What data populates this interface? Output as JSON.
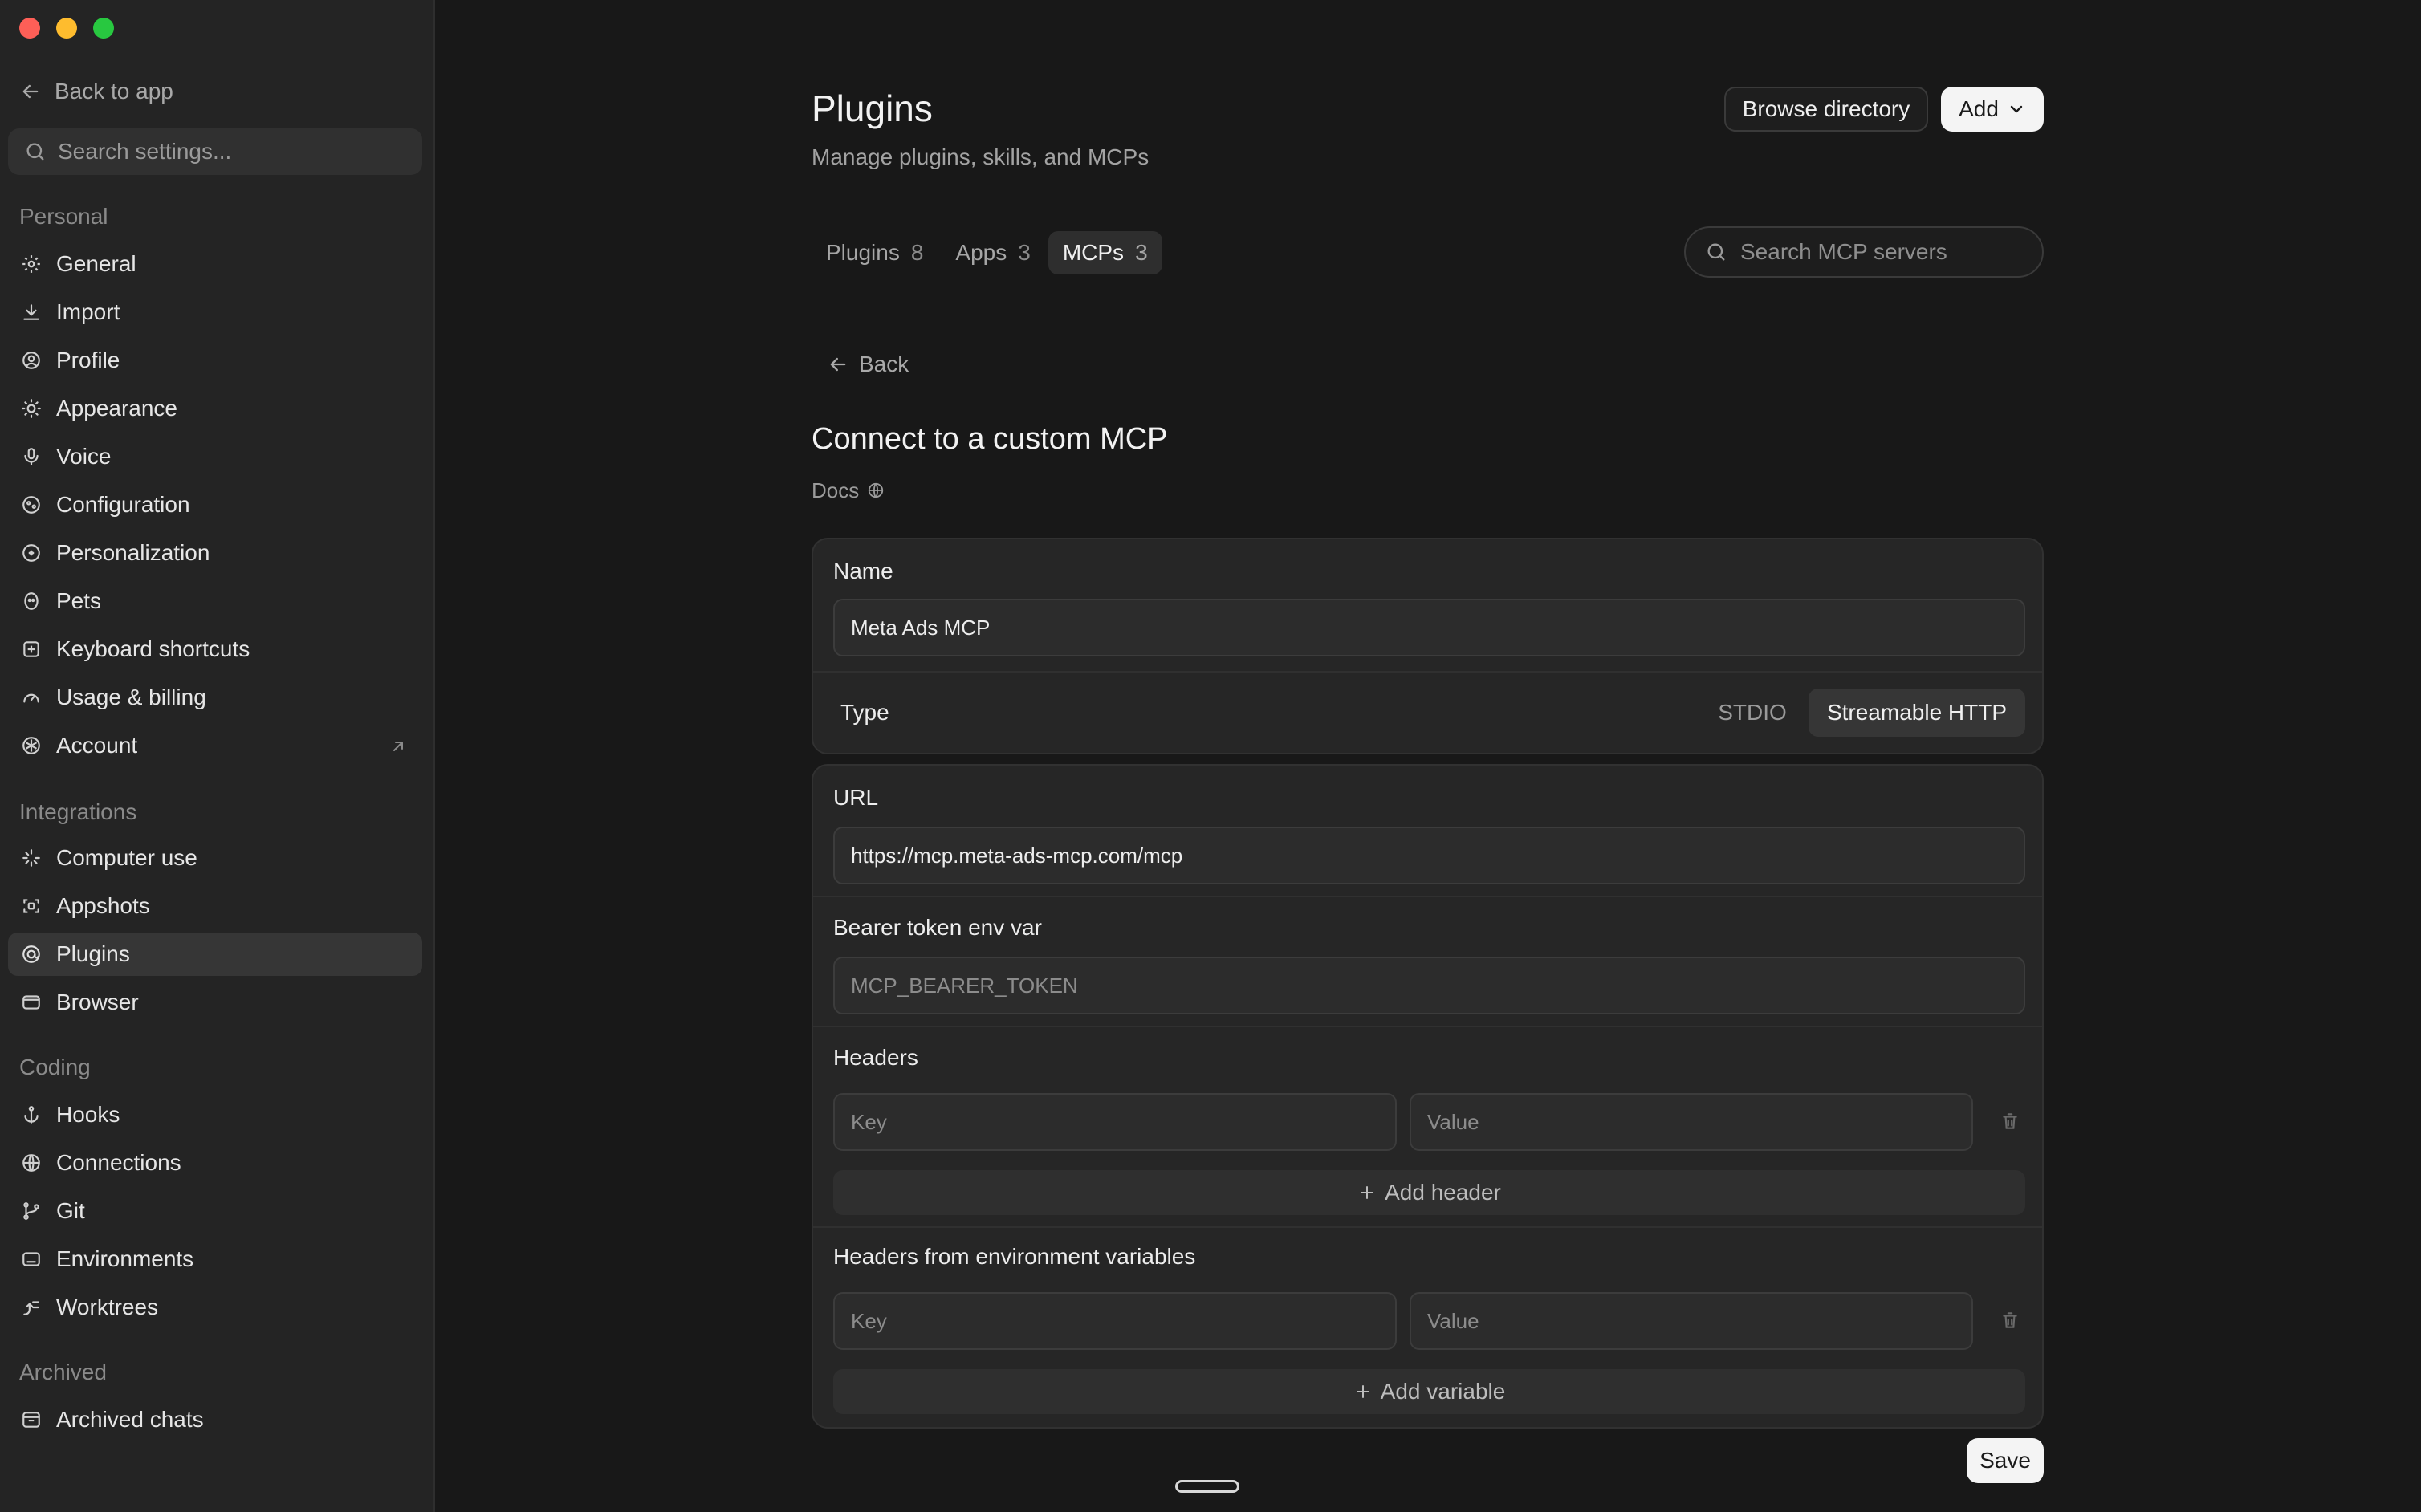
{
  "sidebar": {
    "back_label": "Back to app",
    "search_placeholder": "Search settings...",
    "sections": {
      "personal": "Personal",
      "integrations": "Integrations",
      "coding": "Coding",
      "archived": "Archived"
    },
    "personal_items": [
      {
        "label": "General",
        "icon": "gear-icon"
      },
      {
        "label": "Import",
        "icon": "download-icon"
      },
      {
        "label": "Profile",
        "icon": "user-circle-icon"
      },
      {
        "label": "Appearance",
        "icon": "sun-icon"
      },
      {
        "label": "Voice",
        "icon": "microphone-icon"
      },
      {
        "label": "Configuration",
        "icon": "sliders-icon"
      },
      {
        "label": "Personalization",
        "icon": "sparkle-circle-icon"
      },
      {
        "label": "Pets",
        "icon": "pet-icon"
      },
      {
        "label": "Keyboard shortcuts",
        "icon": "keyboard-icon"
      },
      {
        "label": "Usage & billing",
        "icon": "gauge-icon"
      },
      {
        "label": "Account",
        "icon": "openai-icon"
      }
    ],
    "integration_items": [
      {
        "label": "Computer use",
        "icon": "pointer-sparkle-icon"
      },
      {
        "label": "Appshots",
        "icon": "screenshot-frame-icon"
      },
      {
        "label": "Plugins",
        "icon": "plugin-icon"
      },
      {
        "label": "Browser",
        "icon": "browser-icon"
      }
    ],
    "coding_items": [
      {
        "label": "Hooks",
        "icon": "anchor-icon"
      },
      {
        "label": "Connections",
        "icon": "globe-icon"
      },
      {
        "label": "Git",
        "icon": "git-branch-icon"
      },
      {
        "label": "Environments",
        "icon": "monitor-icon"
      },
      {
        "label": "Worktrees",
        "icon": "worktree-icon"
      }
    ],
    "archived_items": [
      {
        "label": "Archived chats",
        "icon": "archive-icon"
      }
    ],
    "active_item": "Plugins"
  },
  "header": {
    "title": "Plugins",
    "subtitle": "Manage plugins, skills, and MCPs",
    "browse_label": "Browse directory",
    "add_label": "Add"
  },
  "tabs": [
    {
      "label": "Plugins",
      "count": "8"
    },
    {
      "label": "Apps",
      "count": "3"
    },
    {
      "label": "MCPs",
      "count": "3"
    }
  ],
  "active_tab": "MCPs",
  "mcp_search_placeholder": "Search MCP servers",
  "form": {
    "back_label": "Back",
    "title": "Connect to a custom MCP",
    "docs_label": "Docs",
    "name_label": "Name",
    "name_value": "Meta Ads MCP",
    "type_label": "Type",
    "type_options": [
      "STDIO",
      "Streamable HTTP"
    ],
    "type_selected": "Streamable HTTP",
    "url_label": "URL",
    "url_value": "https://mcp.meta-ads-mcp.com/mcp",
    "bearer_label": "Bearer token env var",
    "bearer_placeholder": "MCP_BEARER_TOKEN",
    "headers_label": "Headers",
    "key_placeholder": "Key",
    "value_placeholder": "Value",
    "add_header_label": "Add header",
    "env_headers_label": "Headers from environment variables",
    "add_variable_label": "Add variable",
    "save_label": "Save"
  },
  "colors": {
    "background": "#181818",
    "sidebar": "#242424",
    "card": "#262626",
    "accent_button": "#f4f4f4"
  }
}
